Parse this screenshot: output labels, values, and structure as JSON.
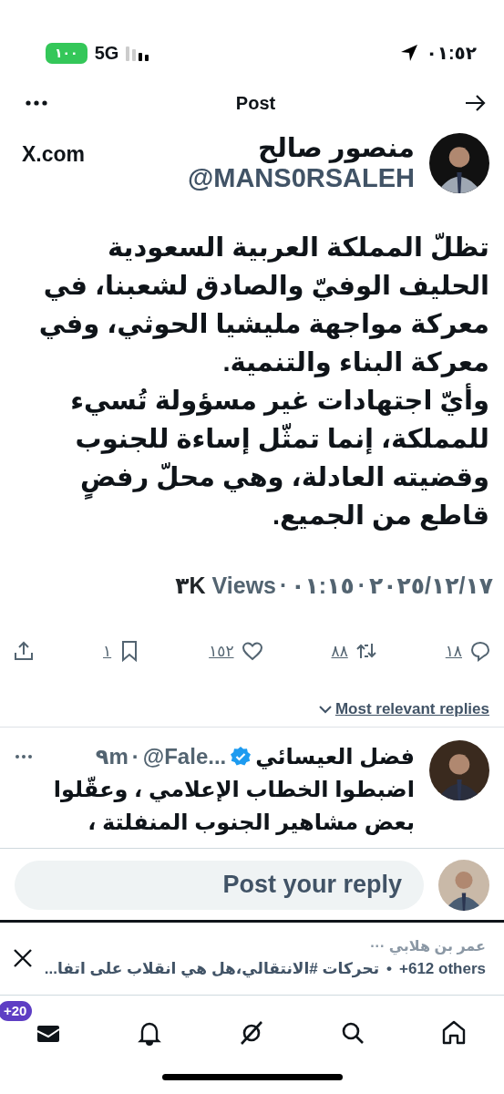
{
  "status_bar": {
    "time": "٠١:٥٢",
    "battery": "١٠٠",
    "network": "5G"
  },
  "header": {
    "title": "Post"
  },
  "author": {
    "name": "منصور صالح",
    "handle": "@MANS0RSALEH",
    "source": "X.com"
  },
  "post": {
    "paragraphs": [
      "تظلّ المملكة العربية السعودية الحليف الوفيّ والصادق لشعبنا، في معركة مواجهة مليشيا الحوثي، وفي معركة البناء والتنمية.",
      "وأيّ اجتهادات غير مسؤولة تُسيء للمملكة، إنما تمثّل إساءة للجنوب وقضيته العادلة، وهي محلّ رفضٍ قاطع من الجميع."
    ]
  },
  "meta": {
    "separator": "·",
    "date": "٢٠٢٥/١٢/١٧",
    "time": "٠١:١٥",
    "views_count": "٣K",
    "views_label": "Views"
  },
  "actions": [
    {
      "kind": "reply",
      "count": "١٨"
    },
    {
      "kind": "repost",
      "count": "٨٨"
    },
    {
      "kind": "like",
      "count": "١٥٢"
    },
    {
      "kind": "bookmark",
      "count": "١"
    },
    {
      "kind": "share"
    }
  ],
  "sort": {
    "label": "Most relevant replies"
  },
  "reply": {
    "name": "فضل العيسائي",
    "verified": true,
    "handle": "@Fale...",
    "separator": "·",
    "time": "٩m",
    "text": "اضبطوا الخطاب الإعلامي ، وعقّلوا بعض مشاهير الجنوب المنفلتة ،"
  },
  "reply_box": {
    "placeholder": "Post your reply"
  },
  "notification": {
    "names": "عمر بن هلابي ···",
    "others": "+612 others",
    "separator": "•",
    "text": "تحركات #الانتقالي،هل هي انقلاب على اتفا..."
  },
  "nav": [
    {
      "kind": "home"
    },
    {
      "kind": "search"
    },
    {
      "kind": "grok"
    },
    {
      "kind": "notifications"
    },
    {
      "kind": "messages",
      "badge": "+20"
    }
  ]
}
